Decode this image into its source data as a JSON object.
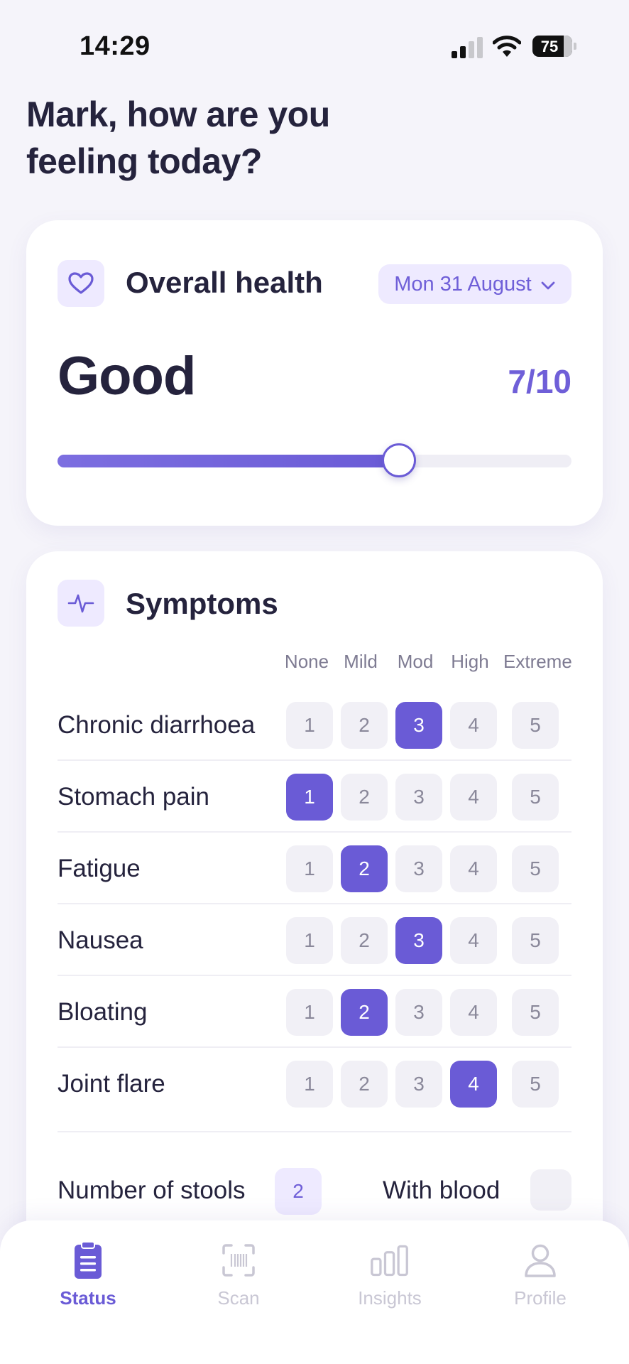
{
  "status_bar": {
    "time": "14:29",
    "battery": "75"
  },
  "greeting": "Mark, how are you feeling today?",
  "health_card": {
    "title": "Overall health",
    "date": "Mon 31 August",
    "value": "Good",
    "score": "7/10",
    "score_value": 7,
    "score_max": 10
  },
  "symptoms_card": {
    "title": "Symptoms",
    "severity_labels": [
      "None",
      "Mild",
      "Mod",
      "High",
      "Extreme"
    ],
    "scale": [
      "1",
      "2",
      "3",
      "4",
      "5"
    ],
    "rows": [
      {
        "label": "Chronic diarrhoea",
        "selected": 3
      },
      {
        "label": "Stomach pain",
        "selected": 1
      },
      {
        "label": "Fatigue",
        "selected": 2
      },
      {
        "label": "Nausea",
        "selected": 3
      },
      {
        "label": "Bloating",
        "selected": 2
      },
      {
        "label": "Joint flare",
        "selected": 4
      }
    ],
    "stools_label": "Number of stools",
    "stools_value": "2",
    "blood_label": "With blood"
  },
  "tabs": [
    {
      "label": "Status",
      "icon": "clipboard-icon",
      "active": true
    },
    {
      "label": "Scan",
      "icon": "barcode-scan-icon",
      "active": false
    },
    {
      "label": "Insights",
      "icon": "bar-chart-icon",
      "active": false
    },
    {
      "label": "Profile",
      "icon": "person-icon",
      "active": false
    }
  ],
  "colors": {
    "accent": "#6a5bd6",
    "accent_light": "#eeeaff",
    "text": "#25233d",
    "background": "#f5f4fa"
  }
}
